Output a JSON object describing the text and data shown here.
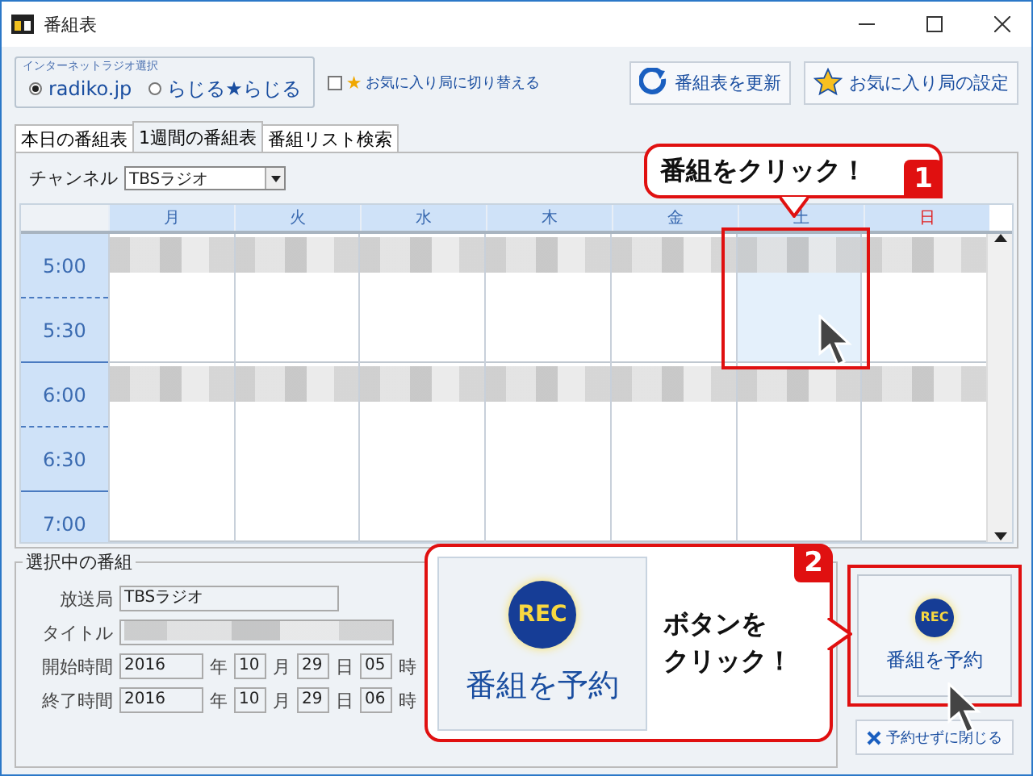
{
  "window": {
    "title": "番組表"
  },
  "toolbar": {
    "source_group": {
      "title": "インターネットラジオ選択",
      "options": [
        {
          "label": "radiko.jp",
          "selected": true
        },
        {
          "label": "らじる★らじる",
          "selected": false
        }
      ]
    },
    "favorite_toggle": {
      "star": "★",
      "label": "お気に入り局に切り替える",
      "checked": false
    },
    "buttons": [
      {
        "kind": "refresh",
        "label": "番組表を更新"
      },
      {
        "kind": "star",
        "label": "お気に入り局の設定"
      }
    ]
  },
  "tabs": [
    {
      "label": "本日の番組表",
      "selected": false
    },
    {
      "label": "1週間の番組表",
      "selected": true
    },
    {
      "label": "番組リスト検索",
      "selected": false
    }
  ],
  "channel": {
    "label": "チャンネル",
    "value": "TBSラジオ"
  },
  "schedule": {
    "days": [
      {
        "label": "月",
        "holiday": false
      },
      {
        "label": "火",
        "holiday": false
      },
      {
        "label": "水",
        "holiday": false
      },
      {
        "label": "木",
        "holiday": false
      },
      {
        "label": "金",
        "holiday": false
      },
      {
        "label": "土",
        "holiday": false
      },
      {
        "label": "日",
        "holiday": true
      }
    ],
    "times": [
      "5:00",
      "5:30",
      "6:00",
      "6:30",
      "7:00"
    ],
    "programs": [
      [
        {
          "kind": "hour",
          "selected": false
        },
        {
          "kind": "rest",
          "selected": false
        }
      ],
      [
        {
          "kind": "hour",
          "selected": false
        },
        {
          "kind": "rest",
          "selected": false
        }
      ],
      [
        {
          "kind": "hour",
          "selected": false
        },
        {
          "kind": "rest",
          "selected": false
        }
      ],
      [
        {
          "kind": "hour",
          "selected": false
        },
        {
          "kind": "rest",
          "selected": false
        }
      ],
      [
        {
          "kind": "hour",
          "selected": false
        },
        {
          "kind": "rest",
          "selected": false
        }
      ],
      [
        {
          "kind": "hour",
          "selected": true
        },
        {
          "kind": "rest",
          "selected": false
        }
      ],
      [
        {
          "kind": "hour",
          "selected": false
        },
        {
          "kind": "rest",
          "selected": false
        }
      ]
    ]
  },
  "selected_program": {
    "title": "選択中の番組",
    "station": {
      "label": "放送局",
      "value": "TBSラジオ"
    },
    "program_title": {
      "label": "タイトル"
    },
    "times": [
      {
        "label": "開始時間",
        "year": "2016",
        "year_unit": "年",
        "month": "10",
        "month_unit": "月",
        "day": "29",
        "day_unit": "日",
        "hour": "05",
        "hour_unit": "時"
      },
      {
        "label": "終了時間",
        "year": "2016",
        "year_unit": "年",
        "month": "10",
        "month_unit": "月",
        "day": "29",
        "day_unit": "日",
        "hour": "06",
        "hour_unit": "時"
      }
    ]
  },
  "actions": {
    "reserve": {
      "badge": "REC",
      "label": "番組を予約"
    },
    "close": {
      "label": "予約せずに閉じる"
    }
  },
  "callout_1": {
    "text": "番組をクリック！",
    "step": "1"
  },
  "callout_2": {
    "badge": "REC",
    "button_label": "番組を予約",
    "lines": [
      "ボタンを",
      "クリック！"
    ],
    "step": "2"
  }
}
